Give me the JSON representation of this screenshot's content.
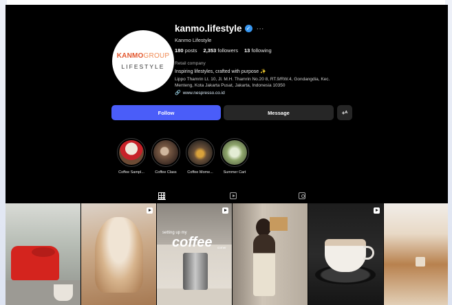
{
  "profile": {
    "avatar_brand_part1": "KANMO",
    "avatar_brand_part2": "GROUP",
    "avatar_sub": "LIFESTYLE",
    "username": "kanmo.lifestyle",
    "verified_mark": "✓",
    "more_label": "···",
    "full_name": "Kanmo Lifestyle",
    "stats": {
      "posts_count": "180",
      "posts_label": "posts",
      "followers_count": "2,353",
      "followers_label": "followers",
      "following_count": "13",
      "following_label": "following"
    },
    "category": "Retail company",
    "bio": "Inspiring lifestyles, crafted with purpose",
    "bio_emoji": "✨",
    "address": "Lippo Thamrin Lt. 10, Jl. M.H. Thamrin No.20 8, RT.9/RW.4, Gondangdia, Kec. Menteng, Kota Jakarta Pusat, Jakarta, Indonesia 10350",
    "link": "www.nespresso.co.id"
  },
  "buttons": {
    "follow_label": "Follow",
    "message_label": "Message",
    "add_user_label": "+ᴬ"
  },
  "highlights": [
    {
      "label": "Coffee Sampl..."
    },
    {
      "label": "Coffee Class"
    },
    {
      "label": "Coffee Mome..."
    },
    {
      "label": "Summer Cart"
    }
  ],
  "tabs": [
    {
      "icon": "grid-icon",
      "active": true
    },
    {
      "icon": "reels-icon",
      "active": false
    },
    {
      "icon": "tagged-icon",
      "active": false
    }
  ],
  "posts": {
    "post3_small_text": "setting up my",
    "post3_big_text": "coffee",
    "post3_small_text2": "corner"
  },
  "colors": {
    "background": "#000000",
    "follow_button": "#4a5df9",
    "secondary_button": "#262626",
    "verified": "#3897f0"
  }
}
